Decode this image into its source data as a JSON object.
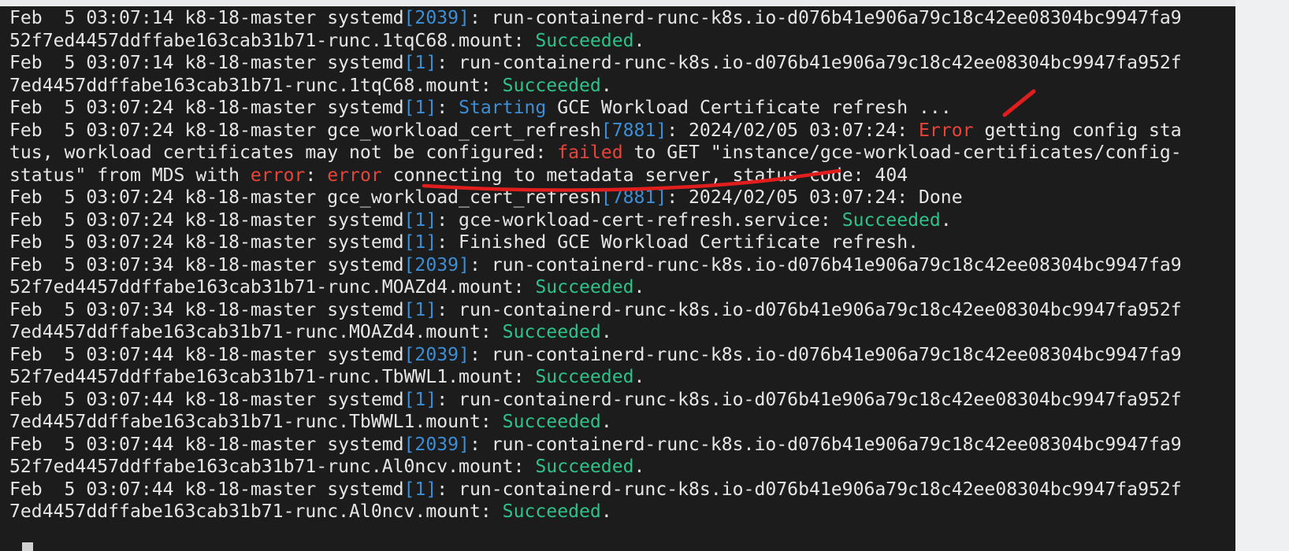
{
  "log": {
    "lines": [
      [
        [
          "Feb  5 03:07:14 k8-18-master systemd",
          ""
        ],
        [
          "[2039]",
          "pid"
        ],
        [
          ": run-containerd-runc-k8s.io-d076b41e906a79c18c42ee08304bc9947fa9",
          ""
        ]
      ],
      [
        [
          "52f7ed4457ddffabe163cab31b71-runc.1tqC68.mount: ",
          ""
        ],
        [
          "Succeeded",
          "ok"
        ],
        [
          ".",
          ""
        ]
      ],
      [
        [
          "Feb  5 03:07:14 k8-18-master systemd",
          ""
        ],
        [
          "[1]",
          "pid"
        ],
        [
          ": run-containerd-runc-k8s.io-d076b41e906a79c18c42ee08304bc9947fa952f",
          ""
        ]
      ],
      [
        [
          "7ed4457ddffabe163cab31b71-runc.1tqC68.mount: ",
          ""
        ],
        [
          "Succeeded",
          "ok"
        ],
        [
          ".",
          ""
        ]
      ],
      [
        [
          "Feb  5 03:07:24 k8-18-master systemd",
          ""
        ],
        [
          "[1]",
          "pid"
        ],
        [
          ": ",
          ""
        ],
        [
          "Starting",
          "kw"
        ],
        [
          " GCE Workload Certificate refresh ...",
          ""
        ]
      ],
      [
        [
          "Feb  5 03:07:24 k8-18-master gce_workload_cert_refresh",
          ""
        ],
        [
          "[7881]",
          "pid"
        ],
        [
          ": 2024/02/05 03:07:24: ",
          ""
        ],
        [
          "Error",
          "err"
        ],
        [
          " getting config sta",
          ""
        ]
      ],
      [
        [
          "tus, workload certificates may not be configured: ",
          ""
        ],
        [
          "failed",
          "err"
        ],
        [
          " to GET \"instance/gce-workload-certificates/config-",
          ""
        ]
      ],
      [
        [
          "status\" from MDS with ",
          ""
        ],
        [
          "error",
          "err"
        ],
        [
          ": ",
          ""
        ],
        [
          "error",
          "err"
        ],
        [
          " connecting to metadata server, status code: 404",
          ""
        ]
      ],
      [
        [
          "Feb  5 03:07:24 k8-18-master gce_workload_cert_refresh",
          ""
        ],
        [
          "[7881]",
          "pid"
        ],
        [
          ": 2024/02/05 03:07:24: Done",
          ""
        ]
      ],
      [
        [
          "Feb  5 03:07:24 k8-18-master systemd",
          ""
        ],
        [
          "[1]",
          "pid"
        ],
        [
          ": gce-workload-cert-refresh.service: ",
          ""
        ],
        [
          "Succeeded",
          "ok"
        ],
        [
          ".",
          ""
        ]
      ],
      [
        [
          "Feb  5 03:07:24 k8-18-master systemd",
          ""
        ],
        [
          "[1]",
          "pid"
        ],
        [
          ": Finished GCE Workload Certificate refresh.",
          ""
        ]
      ],
      [
        [
          "Feb  5 03:07:34 k8-18-master systemd",
          ""
        ],
        [
          "[2039]",
          "pid"
        ],
        [
          ": run-containerd-runc-k8s.io-d076b41e906a79c18c42ee08304bc9947fa9",
          ""
        ]
      ],
      [
        [
          "52f7ed4457ddffabe163cab31b71-runc.MOAZd4.mount: ",
          ""
        ],
        [
          "Succeeded",
          "ok"
        ],
        [
          ".",
          ""
        ]
      ],
      [
        [
          "Feb  5 03:07:34 k8-18-master systemd",
          ""
        ],
        [
          "[1]",
          "pid"
        ],
        [
          ": run-containerd-runc-k8s.io-d076b41e906a79c18c42ee08304bc9947fa952f",
          ""
        ]
      ],
      [
        [
          "7ed4457ddffabe163cab31b71-runc.MOAZd4.mount: ",
          ""
        ],
        [
          "Succeeded",
          "ok"
        ],
        [
          ".",
          ""
        ]
      ],
      [
        [
          "Feb  5 03:07:44 k8-18-master systemd",
          ""
        ],
        [
          "[2039]",
          "pid"
        ],
        [
          ": run-containerd-runc-k8s.io-d076b41e906a79c18c42ee08304bc9947fa9",
          ""
        ]
      ],
      [
        [
          "52f7ed4457ddffabe163cab31b71-runc.TbWWL1.mount: ",
          ""
        ],
        [
          "Succeeded",
          "ok"
        ],
        [
          ".",
          ""
        ]
      ],
      [
        [
          "Feb  5 03:07:44 k8-18-master systemd",
          ""
        ],
        [
          "[1]",
          "pid"
        ],
        [
          ": run-containerd-runc-k8s.io-d076b41e906a79c18c42ee08304bc9947fa952f",
          ""
        ]
      ],
      [
        [
          "7ed4457ddffabe163cab31b71-runc.TbWWL1.mount: ",
          ""
        ],
        [
          "Succeeded",
          "ok"
        ],
        [
          ".",
          ""
        ]
      ],
      [
        [
          "Feb  5 03:07:44 k8-18-master systemd",
          ""
        ],
        [
          "[2039]",
          "pid"
        ],
        [
          ": run-containerd-runc-k8s.io-d076b41e906a79c18c42ee08304bc9947fa9",
          ""
        ]
      ],
      [
        [
          "52f7ed4457ddffabe163cab31b71-runc.Al0ncv.mount: ",
          ""
        ],
        [
          "Succeeded",
          "ok"
        ],
        [
          ".",
          ""
        ]
      ],
      [
        [
          "Feb  5 03:07:44 k8-18-master systemd",
          ""
        ],
        [
          "[1]",
          "pid"
        ],
        [
          ": run-containerd-runc-k8s.io-d076b41e906a79c18c42ee08304bc9947fa952f",
          ""
        ]
      ],
      [
        [
          "7ed4457ddffabe163cab31b71-runc.Al0ncv.mount: ",
          ""
        ],
        [
          "Succeeded",
          "ok"
        ],
        [
          ".",
          ""
        ]
      ]
    ]
  },
  "colors": {
    "background": "#1c1c1c",
    "text": "#e6e6e6",
    "pid": "#3c8fd6",
    "success": "#2ec28a",
    "error": "#e8443a",
    "annotation": "#e01e1e"
  }
}
